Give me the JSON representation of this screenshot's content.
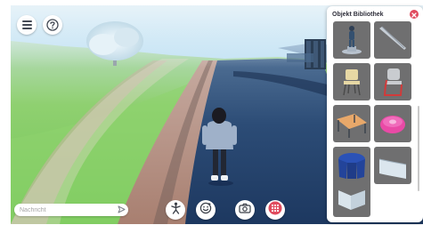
{
  "toolbar": {
    "menu_icon": "hamburger-icon",
    "help_icon": "question-icon"
  },
  "chat": {
    "placeholder": "Nachricht",
    "send_icon": "send-icon"
  },
  "bottom_bar": {
    "buttons": [
      "dance-icon",
      "emote-icon",
      "camera-icon",
      "objects-grid-icon"
    ],
    "active_color": "#e04b5e"
  },
  "library": {
    "title": "Objekt Bibliothek",
    "close_icon": "close-icon",
    "items": [
      "statue",
      "bat",
      "stool-chair",
      "red-chair",
      "desk",
      "round-pink-object",
      "blue-round-table",
      "wall-piece-curved",
      "wall-piece-corner"
    ]
  },
  "colors": {
    "sky": "#cfe7f7",
    "grass": "#7ac95c",
    "road": "#233f66",
    "path": "#b28a7a",
    "accent": "#e04b5e"
  }
}
